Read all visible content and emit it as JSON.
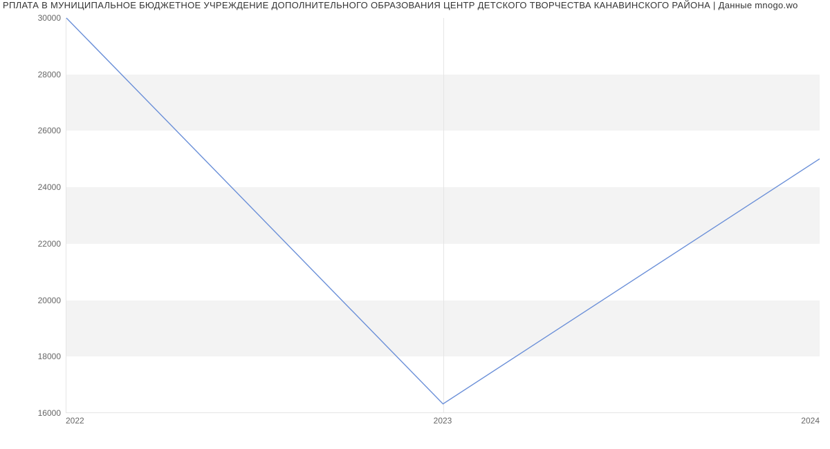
{
  "title_text": "РПЛАТА В МУНИЦИПАЛЬНОЕ БЮДЖЕТНОЕ УЧРЕЖДЕНИЕ ДОПОЛНИТЕЛЬНОГО ОБРАЗОВАНИЯ ЦЕНТР ДЕТСКОГО ТВОРЧЕСТВА КАНАВИНСКОГО РАЙОНА | Данные mnogo.wo",
  "chart_data": {
    "type": "line",
    "x": [
      2022,
      2023,
      2024
    ],
    "values": [
      30000,
      16300,
      25000
    ],
    "ylim": [
      16000,
      30000
    ],
    "y_ticks": [
      16000,
      18000,
      20000,
      22000,
      24000,
      26000,
      28000,
      30000
    ],
    "x_ticks": [
      "2022",
      "2023",
      "2024"
    ],
    "title": "РПЛАТА В МУНИЦИПАЛЬНОЕ БЮДЖЕТНОЕ УЧРЕЖДЕНИЕ ДОПОЛНИТЕЛЬНОГО ОБРАЗОВАНИЯ ЦЕНТР ДЕТСКОГО ТВОРЧЕСТВА КАНАВИНСКОГО РАЙОНА | Данные mnogo.wo",
    "xlabel": "",
    "ylabel": "",
    "line_color": "#6a8fd8"
  }
}
